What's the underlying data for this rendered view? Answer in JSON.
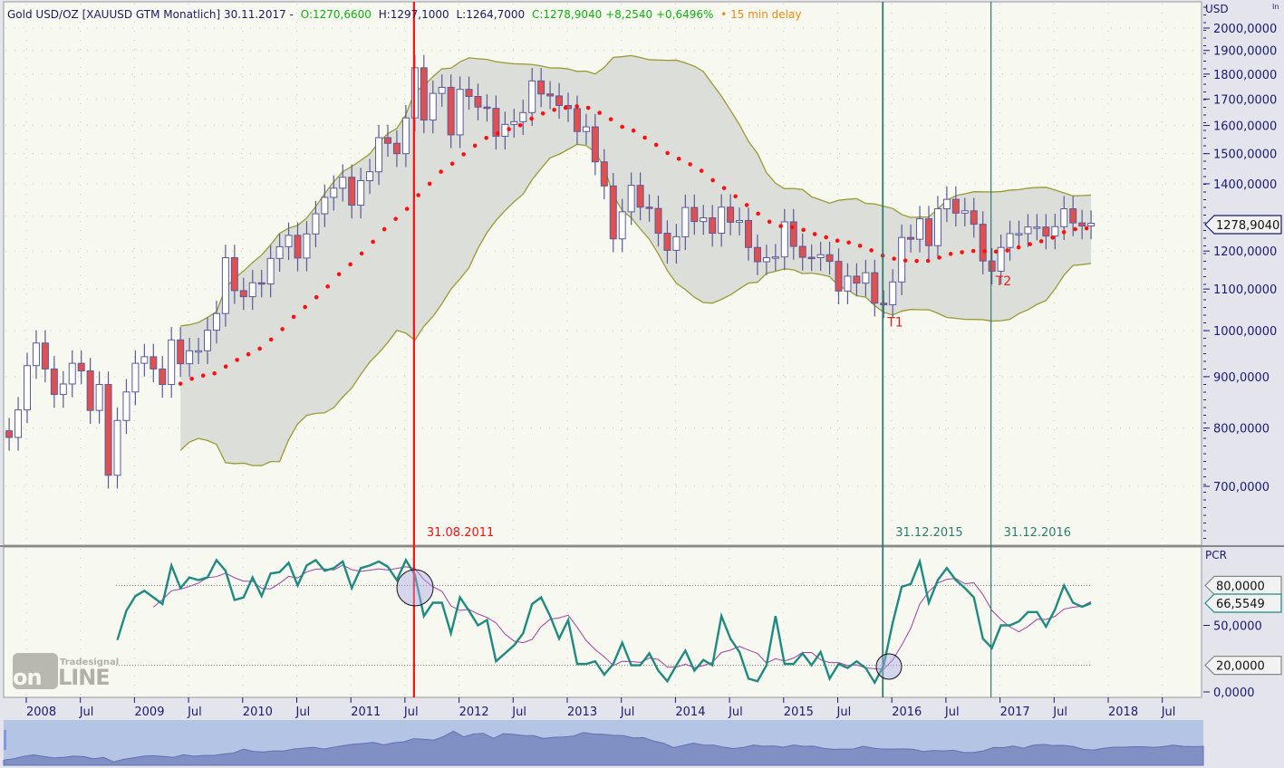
{
  "header": {
    "symbol": "Gold USD/OZ [XAUUSD GTM Monatlich] 30.11.2017 -",
    "open": "O:1270,6600",
    "high": "H:1297,1000",
    "low": "L:1264,7000",
    "close": "C:1278,9040 +8,2540 +0,6496%",
    "delay": "• 15 min delay"
  },
  "price_axis": {
    "unit": "USD",
    "corner": "In",
    "ticks": [
      2000,
      1900,
      1800,
      1700,
      1600,
      1500,
      1400,
      1200,
      1100,
      1000,
      900,
      800,
      700
    ],
    "tick_labels": [
      "2000,0000",
      "1900,0000",
      "1800,0000",
      "1700,0000",
      "1600,0000",
      "1500,0000",
      "1400,0000",
      "1200,0000",
      "1100,0000",
      "1000,0000",
      "900,0000",
      "800,0000",
      "700,0000"
    ],
    "last_value": 1278.904,
    "last_label": "1278,9040"
  },
  "indicator_axis": {
    "unit": "PCR",
    "ticks": [
      50,
      0
    ],
    "tick_labels": [
      "50,0000",
      "0,0000"
    ],
    "levels": [
      80,
      20
    ],
    "level_labels": [
      "80,0000",
      "20,0000"
    ],
    "last_value": 66.5549,
    "last_label": "66,5549"
  },
  "time_axis": [
    {
      "label": "2008",
      "m": 0
    },
    {
      "label": "Jul",
      "m": 6
    },
    {
      "label": "2009",
      "m": 12
    },
    {
      "label": "Jul",
      "m": 18
    },
    {
      "label": "2010",
      "m": 24
    },
    {
      "label": "Jul",
      "m": 30
    },
    {
      "label": "2011",
      "m": 36
    },
    {
      "label": "Jul",
      "m": 42
    },
    {
      "label": "2012",
      "m": 48
    },
    {
      "label": "Jul",
      "m": 54
    },
    {
      "label": "2013",
      "m": 60
    },
    {
      "label": "Jul",
      "m": 66
    },
    {
      "label": "2014",
      "m": 72
    },
    {
      "label": "Jul",
      "m": 78
    },
    {
      "label": "2015",
      "m": 84
    },
    {
      "label": "Jul",
      "m": 90
    },
    {
      "label": "2016",
      "m": 96
    },
    {
      "label": "Jul",
      "m": 102
    },
    {
      "label": "2017",
      "m": 108
    },
    {
      "label": "Jul",
      "m": 114
    },
    {
      "label": "2018",
      "m": 120
    },
    {
      "label": "Jul",
      "m": 126
    }
  ],
  "markers": [
    {
      "label": "31.08.2011",
      "m": 43,
      "color": "#ff1010"
    },
    {
      "label": "31.12.2015",
      "m": 95,
      "color": "#2f7a6e"
    },
    {
      "label": "31.12.2016",
      "m": 107,
      "color": "#2f7a6e"
    }
  ],
  "annotations": [
    {
      "label": "T1",
      "m": 95,
      "price": 1010
    },
    {
      "label": "T2",
      "m": 107,
      "price": 1110
    }
  ],
  "logo": "Tradesignal online",
  "colors": {
    "bg": "#f7f9f0",
    "up": "#ffffff",
    "down": "#e05050",
    "outline": "#5a5a9a",
    "band": "#9a9a30",
    "bandFill": "#dcdeda",
    "sma": "#ff1010",
    "pcr": "#1f8a80",
    "signal": "#a040a0",
    "navBg": "#b4c4e4",
    "navFill": "#8090c4"
  },
  "chart_data": {
    "type": "candlestick",
    "title": "Gold USD/OZ monthly",
    "start_month": "2007-11",
    "first_open": 795,
    "close": [
      783,
      834,
      923,
      972,
      916,
      864,
      885,
      928,
      912,
      833,
      884,
      718,
      814,
      869,
      928,
      942,
      916,
      884,
      979,
      927,
      955,
      955,
      1001,
      1040,
      1182,
      1096,
      1081,
      1116,
      1113,
      1180,
      1212,
      1244,
      1181,
      1248,
      1307,
      1357,
      1386,
      1421,
      1333,
      1410,
      1439,
      1556,
      1536,
      1500,
      1628,
      1826,
      1620,
      1722,
      1746,
      1566,
      1738,
      1710,
      1669,
      1664,
      1561,
      1604,
      1614,
      1648,
      1772,
      1720,
      1712,
      1675,
      1663,
      1578,
      1595,
      1472,
      1393,
      1234,
      1313,
      1395,
      1327,
      1323,
      1250,
      1202,
      1240,
      1326,
      1284,
      1295,
      1250,
      1327,
      1282,
      1287,
      1210,
      1171,
      1182,
      1184,
      1283,
      1213,
      1183,
      1182,
      1190,
      1172,
      1095,
      1133,
      1115,
      1142,
      1065,
      1061,
      1118,
      1238,
      1233,
      1292,
      1215,
      1322,
      1351,
      1309,
      1316,
      1276,
      1173,
      1146,
      1210,
      1249,
      1249,
      1268,
      1268,
      1242,
      1269,
      1322,
      1280,
      1271,
      1278.9
    ],
    "pcr_start_m": 10,
    "pcr": [
      39,
      61,
      72,
      76,
      71,
      66,
      95,
      78,
      86,
      84,
      86,
      99,
      91,
      69,
      71,
      86,
      72,
      89,
      90,
      97,
      80,
      95,
      99,
      91,
      93,
      98,
      78,
      93,
      95,
      98,
      94,
      84,
      99,
      88,
      57,
      67,
      67,
      44,
      71,
      61,
      50,
      54,
      23,
      29,
      35,
      44,
      66,
      71,
      57,
      40,
      54,
      21,
      21,
      23,
      13,
      21,
      37,
      20,
      20,
      29,
      16,
      8,
      20,
      31,
      16,
      24,
      20,
      57,
      40,
      30,
      10,
      8,
      20,
      57,
      21,
      21,
      29,
      20,
      30,
      10,
      21,
      18,
      23,
      18,
      7,
      20,
      52,
      79,
      81,
      98,
      67,
      84,
      93,
      84,
      78,
      71,
      40,
      33,
      50,
      50,
      53,
      60,
      60,
      49,
      62,
      80,
      67,
      64,
      66.55
    ],
    "bollinger_period": 20,
    "bollinger_std": 2,
    "ylim": [
      650,
      2050
    ],
    "yscale": "log"
  }
}
